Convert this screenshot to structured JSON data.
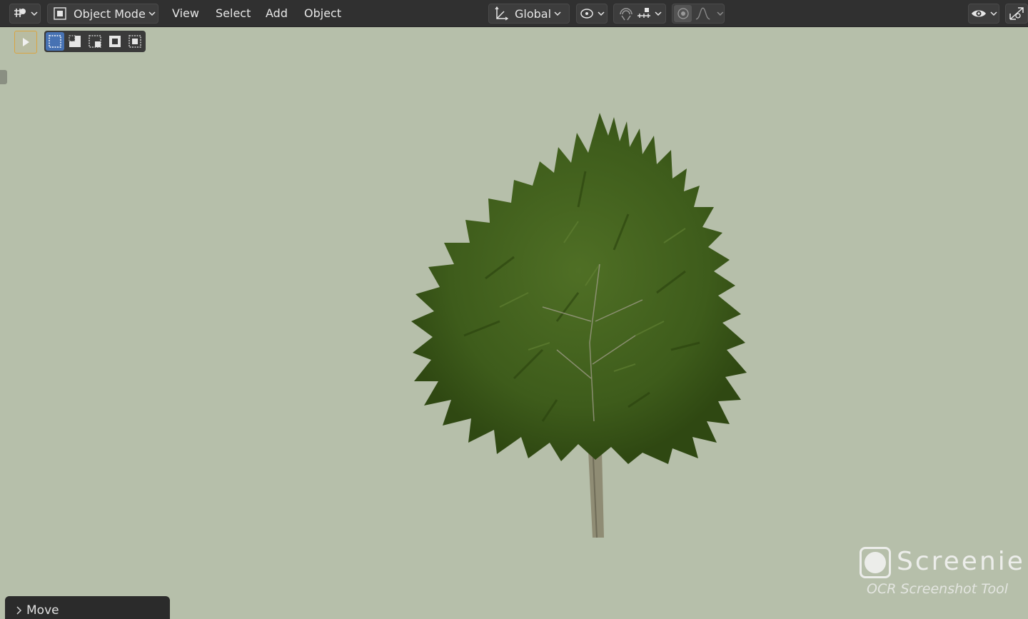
{
  "header": {
    "editor_type_icon": "editor-type-icon",
    "mode": {
      "label": "Object Mode",
      "icon": "object-mode-icon"
    },
    "menus": [
      "View",
      "Select",
      "Add",
      "Object"
    ],
    "transform_orientation": {
      "label": "Global",
      "icon": "orientation-icon"
    },
    "pivot_icon": "pivot-point-icon",
    "snap_icon": "magnet-icon",
    "snap_target_icon": "snap-increment-icon",
    "proportional_icon": "proportional-edit-icon",
    "falloff_icon": "falloff-curve-icon",
    "visibility_icon": "eye-icon",
    "gizmo_icon": "gizmo-icon"
  },
  "toolbar": {
    "active_tool_icon": "cursor-select-icon",
    "selection_modes": [
      "select-new-icon",
      "select-extend-icon",
      "select-subtract-icon",
      "select-invert-icon",
      "select-intersect-icon"
    ]
  },
  "watermark": {
    "name": "Screenie",
    "subtitle": "OCR Screenshot Tool"
  },
  "operator_panel": {
    "label": "Move"
  },
  "colors": {
    "viewport": "#b6bfaa",
    "header": "#303030",
    "accent": "#4772b3",
    "active_tool": "#d9a441"
  }
}
